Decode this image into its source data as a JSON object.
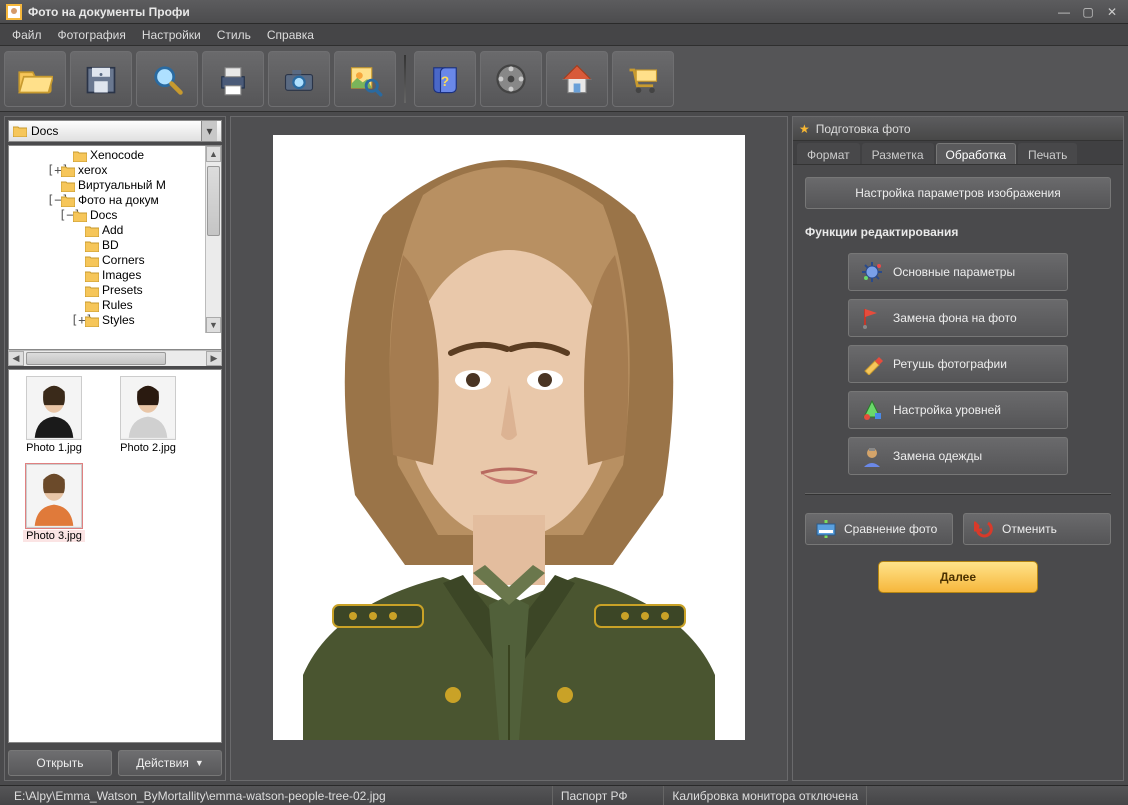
{
  "app": {
    "title": "Фото на документы Профи"
  },
  "menu": {
    "items": [
      "Файл",
      "Фотография",
      "Настройки",
      "Стиль",
      "Справка"
    ]
  },
  "toolbar": {
    "buttons": [
      {
        "name": "open-folder"
      },
      {
        "name": "save"
      },
      {
        "name": "search"
      },
      {
        "name": "print"
      },
      {
        "name": "camera"
      },
      {
        "name": "preview"
      }
    ],
    "buttons2": [
      {
        "name": "help-book"
      },
      {
        "name": "video"
      },
      {
        "name": "home"
      },
      {
        "name": "cart"
      }
    ]
  },
  "breadcrumb": {
    "path": "Docs"
  },
  "tree": {
    "rows": [
      {
        "indent": 4,
        "exp": "",
        "label": "Xenocode"
      },
      {
        "indent": 3,
        "exp": "+",
        "label": "xerox"
      },
      {
        "indent": 3,
        "exp": "",
        "label": "Виртуальный М"
      },
      {
        "indent": 3,
        "exp": "−",
        "label": "Фото на докум"
      },
      {
        "indent": 4,
        "exp": "−",
        "label": "Docs"
      },
      {
        "indent": 5,
        "exp": "",
        "label": "Add"
      },
      {
        "indent": 5,
        "exp": "",
        "label": "BD"
      },
      {
        "indent": 5,
        "exp": "",
        "label": "Corners"
      },
      {
        "indent": 5,
        "exp": "",
        "label": "Images"
      },
      {
        "indent": 5,
        "exp": "",
        "label": "Presets"
      },
      {
        "indent": 5,
        "exp": "",
        "label": "Rules"
      },
      {
        "indent": 5,
        "exp": "+",
        "label": "Styles"
      }
    ]
  },
  "thumbs": {
    "items": [
      {
        "label": "Photo 1.jpg",
        "selected": false,
        "hair": "#3a2a1a",
        "skin": "#e9c6a7",
        "shirt": "#1a1a1a"
      },
      {
        "label": "Photo 2.jpg",
        "selected": false,
        "hair": "#2a1a10",
        "skin": "#e9c6a7",
        "shirt": "#d0d0d0"
      },
      {
        "label": "Photo 3.jpg",
        "selected": true,
        "hair": "#6b4a2a",
        "skin": "#e9c6a7",
        "shirt": "#e07a3a"
      }
    ]
  },
  "leftButtons": {
    "open": "Открыть",
    "actions": "Действия"
  },
  "rightPanel": {
    "headerTitle": "Подготовка фото",
    "tabs": [
      "Формат",
      "Разметка",
      "Обработка",
      "Печать"
    ],
    "activeTab": 2,
    "settingsButton": "Настройка параметров изображения",
    "sectionTitle": "Функции редактирования",
    "editButtons": [
      {
        "icon": "gear",
        "label": "Основные параметры"
      },
      {
        "icon": "flag",
        "label": "Замена фона на фото"
      },
      {
        "icon": "brush",
        "label": "Ретушь фотографии"
      },
      {
        "icon": "levels",
        "label": "Настройка уровней"
      },
      {
        "icon": "costume",
        "label": "Замена одежды"
      }
    ],
    "compare": "Сравнение фото",
    "cancel": "Отменить",
    "next": "Далее"
  },
  "statusbar": {
    "path": "E:\\Alpy\\Emma_Watson_ByMortallity\\emma-watson-people-tree-02.jpg",
    "format": "Паспорт РФ",
    "calibration": "Калибровка монитора отключена"
  },
  "portrait": {
    "skin": "#e8c4a6",
    "hair": "#a07a4a",
    "uniformMain": "#4a5530",
    "uniformDark": "#3a4424",
    "tie": "#4a5530",
    "collar": "#3c4626",
    "buttons": "#c9a227"
  }
}
